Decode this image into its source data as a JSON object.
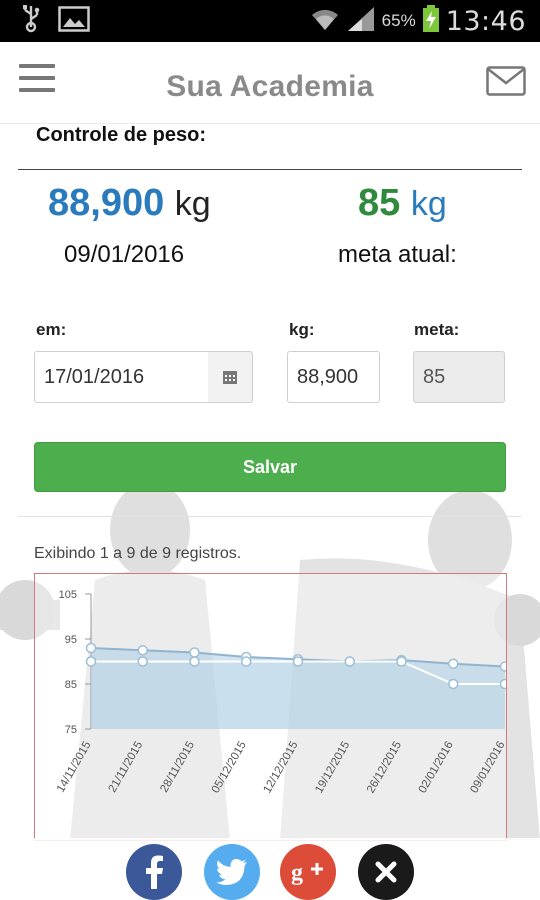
{
  "status_bar": {
    "battery_percent": "65%",
    "time": "13:46"
  },
  "header": {
    "title": "Sua Academia",
    "menu_icon": "hamburger-menu-icon",
    "mail_icon": "envelope-icon"
  },
  "weight_control": {
    "title": "Controle de peso:",
    "current_weight": "88,900",
    "current_unit": "kg",
    "current_date": "09/01/2016",
    "goal_weight": "85",
    "goal_unit": "kg",
    "goal_label": "meta atual:"
  },
  "form": {
    "date_label": "em:",
    "date_value": "17/01/2016",
    "calendar_icon": "calendar-icon",
    "kg_label": "kg:",
    "kg_value": "88,900",
    "goal_label": "meta:",
    "goal_value": "85",
    "save_label": "Salvar"
  },
  "records_info": "Exibindo 1 a 9 de 9 registros.",
  "colors": {
    "current_weight": "#2a7bbd",
    "goal_weight": "#2f8a3e",
    "save_button": "#4cae4c",
    "chart_border": "#d17a7a",
    "facebook": "#3b5998",
    "twitter": "#55acee",
    "google_plus": "#dd4b39",
    "close": "#1a1a1a"
  },
  "chart_data": {
    "type": "line",
    "categories": [
      "14/11/2015",
      "21/11/2015",
      "28/11/2015",
      "05/12/2015",
      "12/12/2015",
      "19/12/2015",
      "26/12/2015",
      "02/01/2016",
      "09/01/2016"
    ],
    "y_ticks": [
      "105",
      "95",
      "85",
      "75"
    ],
    "ylim": [
      75,
      105
    ],
    "grid": false,
    "series": [
      {
        "values": [
          93,
          92.5,
          92,
          91,
          90.5,
          90,
          90.3,
          89.5,
          88.9
        ]
      },
      {
        "values": [
          90,
          90,
          90,
          90,
          90,
          90,
          90,
          85,
          85
        ]
      }
    ]
  },
  "share": {
    "facebook_icon": "facebook-icon",
    "twitter_icon": "twitter-icon",
    "google_plus_icon": "google-plus-icon",
    "close_icon": "close-icon"
  }
}
